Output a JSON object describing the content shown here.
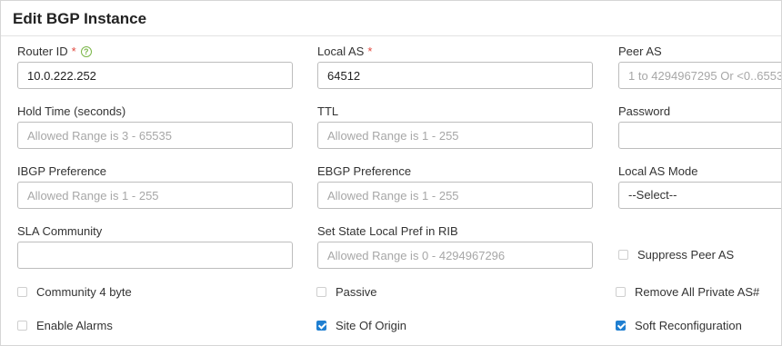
{
  "title": "Edit BGP Instance",
  "required_mark": "*",
  "help_glyph": "?",
  "fields": {
    "router_id": {
      "label": "Router ID",
      "value": "10.0.222.252"
    },
    "local_as": {
      "label": "Local AS",
      "value": "64512"
    },
    "peer_as": {
      "label": "Peer AS",
      "placeholder": "1 to 4294967295 Or <0..6553"
    },
    "hold_time": {
      "label": "Hold Time (seconds)",
      "placeholder": "Allowed Range is 3 - 65535"
    },
    "ttl": {
      "label": "TTL",
      "placeholder": "Allowed Range is 1 - 255"
    },
    "password": {
      "label": "Password",
      "value": ""
    },
    "ibgp_pref": {
      "label": "IBGP Preference",
      "placeholder": "Allowed Range is 1 - 255"
    },
    "ebgp_pref": {
      "label": "EBGP Preference",
      "placeholder": "Allowed Range is 1 - 255"
    },
    "local_as_mode": {
      "label": "Local AS Mode",
      "value": "--Select--"
    },
    "sla_community": {
      "label": "SLA Community",
      "value": ""
    },
    "set_state_local_pref": {
      "label": "Set State Local Pref in RIB",
      "placeholder": "Allowed Range is 0 - 4294967296"
    }
  },
  "checkboxes": {
    "suppress_peer_as": {
      "label": "Suppress Peer AS",
      "checked": false
    },
    "community_4byte": {
      "label": "Community 4 byte",
      "checked": false
    },
    "passive": {
      "label": "Passive",
      "checked": false
    },
    "remove_private_as": {
      "label": "Remove All Private AS#",
      "checked": false
    },
    "enable_alarms": {
      "label": "Enable Alarms",
      "checked": false
    },
    "site_of_origin": {
      "label": "Site Of Origin",
      "checked": true
    },
    "soft_reconfiguration": {
      "label": "Soft Reconfiguration",
      "checked": true
    }
  },
  "colors": {
    "accent": "#1f7fd1",
    "required": "#e0483e",
    "help": "#7ab648"
  }
}
